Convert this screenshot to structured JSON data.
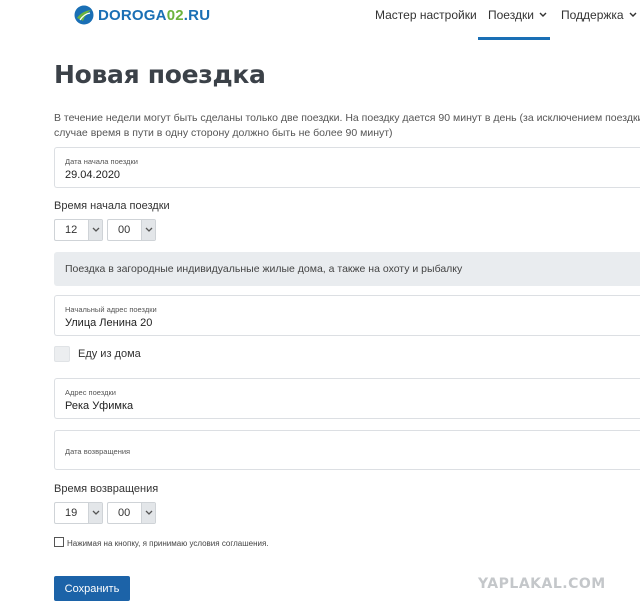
{
  "header": {
    "logo_part1": "DOROGA",
    "logo_part2": "02",
    "logo_part3": ".RU",
    "nav": [
      {
        "label": "Мастер настройки"
      },
      {
        "label": "Поездки",
        "active": true
      },
      {
        "label": "Поддержка"
      }
    ],
    "accent_color": "#1a6fb5"
  },
  "page": {
    "title": "Новая поездка",
    "intro_line1": "В течение недели могут быть сделаны только две поездки. На поездку дается 90 минут в день (за исключением поездки в",
    "intro_line2": "случае время в пути в одну сторону должно быть не более 90 минут)"
  },
  "form": {
    "start_date": {
      "label": "Дата начала поездки",
      "value": "29.04.2020"
    },
    "start_time": {
      "label": "Время начала поездки",
      "hour": "12",
      "minute": "00"
    },
    "trip_type": "Поездка в загородные индивидуальные жилые дома, а также на охоту и рыбалку",
    "start_address": {
      "label": "Начальный адрес поездки",
      "value": "Улица Ленина 20"
    },
    "from_home": {
      "label": "Еду из дома",
      "checked": false
    },
    "trip_address": {
      "label": "Адрес поездки",
      "value": "Река Уфимка"
    },
    "return_date": {
      "label": "Дата возвращения",
      "value": ""
    },
    "return_time": {
      "label": "Время возвращения",
      "hour": "19",
      "minute": "00"
    },
    "agreement": {
      "label": "Нажимая на кнопку, я принимаю условия соглашения.",
      "checked": false
    },
    "save_label": "Сохранить"
  },
  "watermark": "YAPLAKAL.COM"
}
